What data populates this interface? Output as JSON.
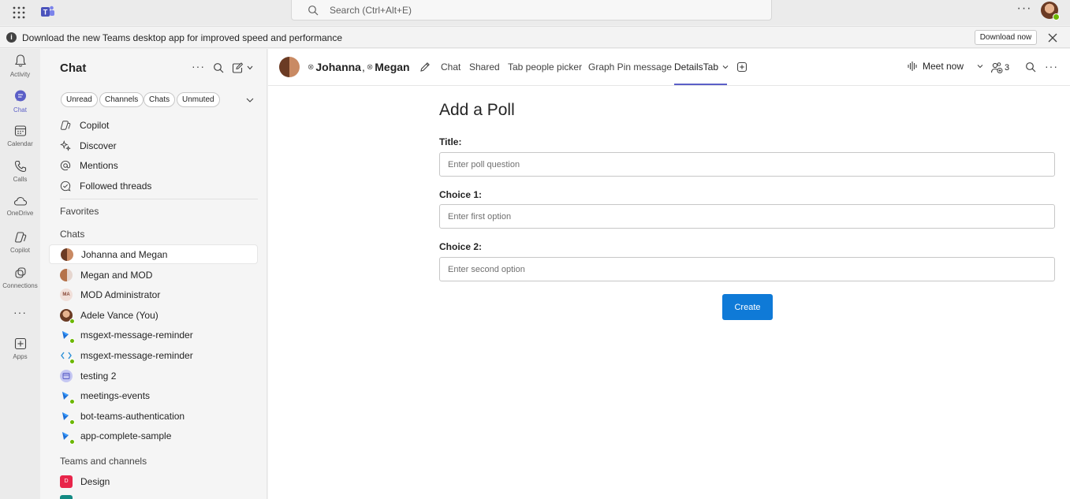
{
  "topbar": {
    "search_placeholder": "Search (Ctrl+Alt+E)",
    "more_label": "···"
  },
  "banner": {
    "message": "Download the new Teams desktop app for improved speed and performance",
    "download_label": "Download now"
  },
  "rail": {
    "items": [
      {
        "label": "Activity",
        "icon": "bell-icon"
      },
      {
        "label": "Chat",
        "icon": "chat-icon",
        "active": true
      },
      {
        "label": "Calendar",
        "icon": "calendar-icon"
      },
      {
        "label": "Calls",
        "icon": "phone-icon"
      },
      {
        "label": "OneDrive",
        "icon": "cloud-icon"
      },
      {
        "label": "Copilot",
        "icon": "copilot-icon"
      },
      {
        "label": "Connections",
        "icon": "connections-icon"
      },
      {
        "label": "Apps",
        "icon": "add-apps-icon"
      }
    ],
    "more_label": "···"
  },
  "chat_list": {
    "title": "Chat",
    "more_label": "···",
    "filters": [
      "Unread",
      "Channels",
      "Chats",
      "Unmuted"
    ],
    "nav": [
      {
        "label": "Copilot",
        "icon": "copilot-icon"
      },
      {
        "label": "Discover",
        "icon": "sparkle-icon"
      },
      {
        "label": "Mentions",
        "icon": "at-icon"
      },
      {
        "label": "Followed threads",
        "icon": "followed-icon"
      }
    ],
    "favorites_label": "Favorites",
    "chats_label": "Chats",
    "chats": [
      {
        "name": "Johanna and Megan",
        "selected": true
      },
      {
        "name": "Megan and MOD"
      },
      {
        "name": "MOD Administrator",
        "initials": "MA"
      },
      {
        "name": "Adele Vance (You)"
      },
      {
        "name": "msgext-message-reminder"
      },
      {
        "name": "msgext-message-reminder"
      },
      {
        "name": "testing 2"
      },
      {
        "name": "meetings-events"
      },
      {
        "name": "bot-teams-authentication"
      },
      {
        "name": "app-complete-sample"
      }
    ],
    "teams_label": "Teams and channels",
    "teams": [
      {
        "name": "Design",
        "initial": "D",
        "color": "#e8254a"
      }
    ]
  },
  "header": {
    "participant_1": "Johanna",
    "separator": ",",
    "participant_2": "Megan",
    "tabs": [
      "Chat",
      "Shared",
      "Tab people picker",
      "Graph Pin message",
      "DetailsTab"
    ],
    "active_tab": "DetailsTab",
    "meet_now_label": "Meet now",
    "participant_count": "3",
    "more_label": "···"
  },
  "poll": {
    "heading": "Add a Poll",
    "title_label": "Title:",
    "title_placeholder": "Enter poll question",
    "choice1_label": "Choice 1:",
    "choice1_placeholder": "Enter first option",
    "choice2_label": "Choice 2:",
    "choice2_placeholder": "Enter second option",
    "create_label": "Create"
  },
  "colors": {
    "accent": "#5b5fc7",
    "create_button": "#0f7ad7",
    "presence_available": "#6bb700"
  }
}
